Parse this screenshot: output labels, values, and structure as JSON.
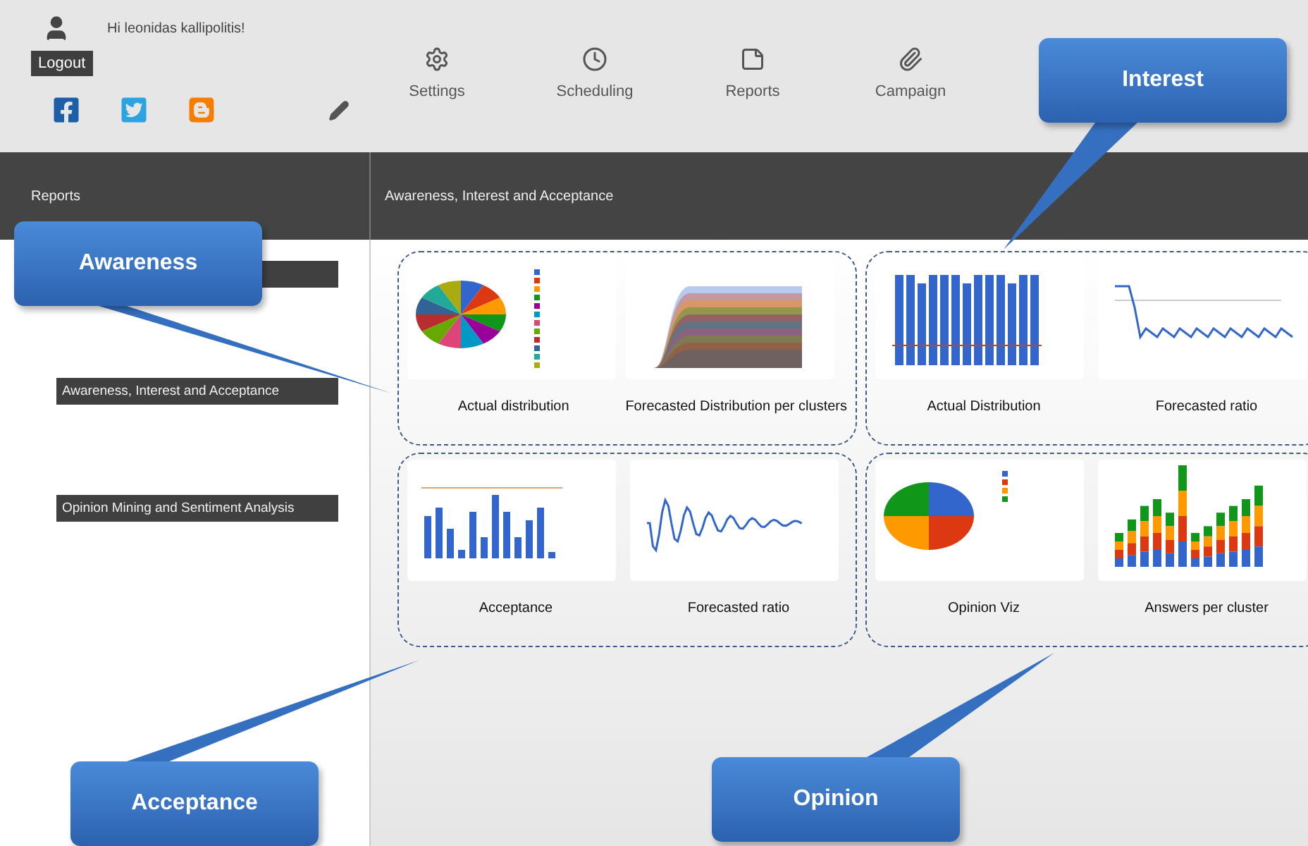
{
  "header": {
    "greeting": "Hi leonidas kallipolitis!",
    "logout": "Logout"
  },
  "nav": [
    {
      "label": "Settings"
    },
    {
      "label": "Scheduling"
    },
    {
      "label": "Reports"
    },
    {
      "label": "Campaign"
    }
  ],
  "sidebar": {
    "title": "Reports",
    "items": [
      "Awareness, Interest and Acceptance",
      "Opinion Mining and Sentiment Analysis"
    ]
  },
  "content": {
    "title": "Awareness, Interest and Acceptance",
    "groups": [
      {
        "tiles": [
          {
            "label": "Actual distribution",
            "kind": "pie"
          },
          {
            "label": "Forecasted Distribution per clusters",
            "kind": "area"
          }
        ]
      },
      {
        "tiles": [
          {
            "label": "Actual Distribution",
            "kind": "bars"
          },
          {
            "label": "Forecasted ratio",
            "kind": "drop"
          }
        ]
      },
      {
        "tiles": [
          {
            "label": "Acceptance",
            "kind": "smallbars"
          },
          {
            "label": "Forecasted ratio",
            "kind": "wave"
          }
        ]
      },
      {
        "tiles": [
          {
            "label": "Opinion Viz",
            "kind": "pie4"
          },
          {
            "label": "Answers per cluster",
            "kind": "stacked"
          }
        ]
      }
    ]
  },
  "callouts": [
    {
      "label": "Awareness",
      "kind": "awareness"
    },
    {
      "label": "Interest",
      "kind": "interest"
    },
    {
      "label": "Acceptance",
      "kind": "acceptance"
    },
    {
      "label": "Opinion",
      "kind": "opinion"
    }
  ]
}
